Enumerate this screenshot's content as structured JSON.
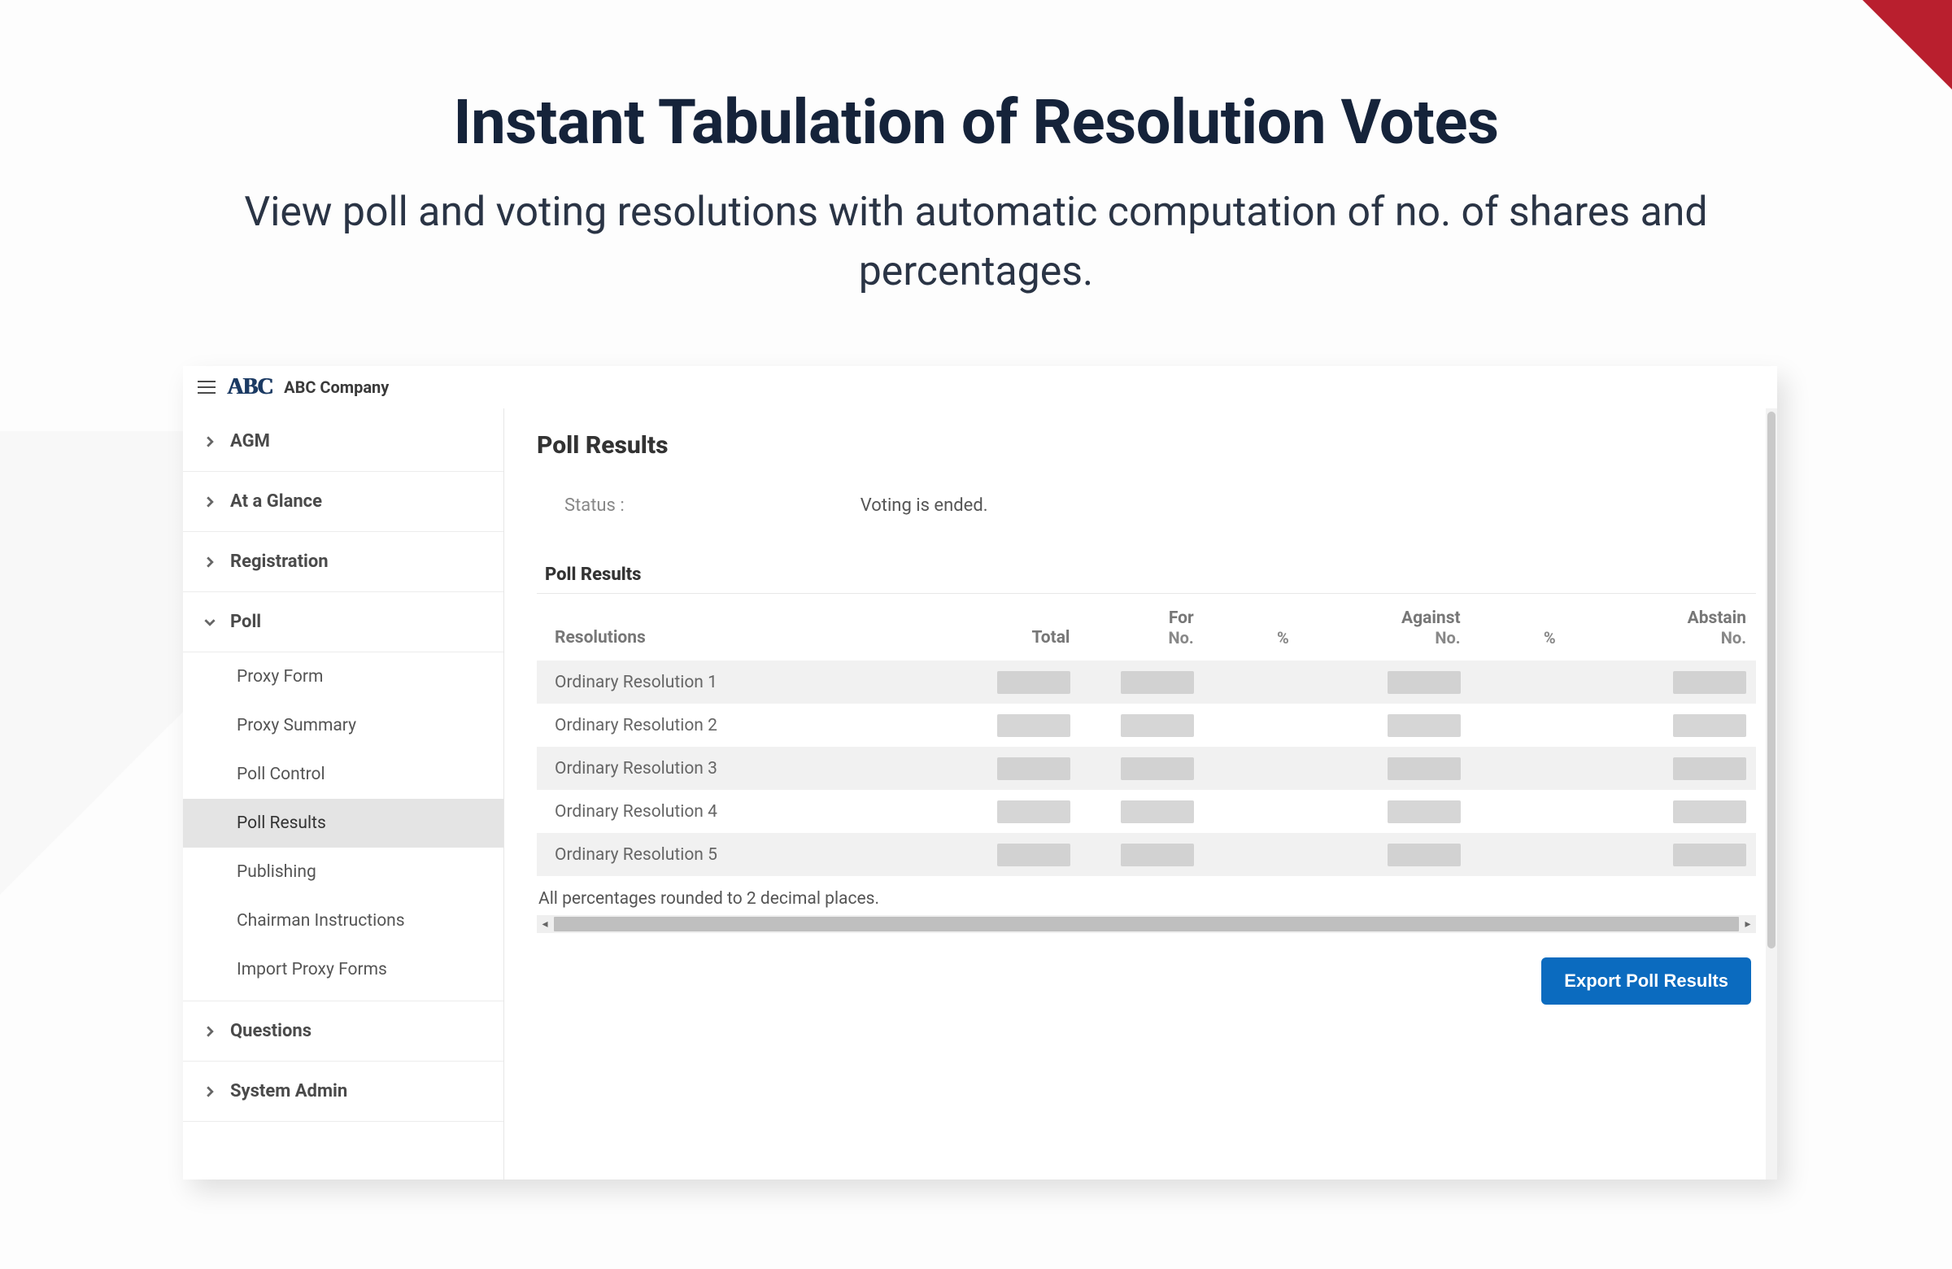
{
  "hero": {
    "title": "Instant Tabulation of Resolution Votes",
    "subtitle": "View poll and voting resolutions with automatic computation of no. of shares and percentages."
  },
  "app": {
    "logo_text": "ABC",
    "company": "ABC Company"
  },
  "sidebar": {
    "items": [
      {
        "label": "AGM",
        "expanded": false
      },
      {
        "label": "At a Glance",
        "expanded": false
      },
      {
        "label": "Registration",
        "expanded": false
      },
      {
        "label": "Poll",
        "expanded": true,
        "children": [
          {
            "label": "Proxy Form",
            "active": false
          },
          {
            "label": "Proxy Summary",
            "active": false
          },
          {
            "label": "Poll Control",
            "active": false
          },
          {
            "label": "Poll Results",
            "active": true
          },
          {
            "label": "Publishing",
            "active": false
          },
          {
            "label": "Chairman Instructions",
            "active": false
          },
          {
            "label": "Import Proxy Forms",
            "active": false
          }
        ]
      },
      {
        "label": "Questions",
        "expanded": false
      },
      {
        "label": "System Admin",
        "expanded": false
      }
    ]
  },
  "main": {
    "page_title": "Poll Results",
    "status_label": "Status :",
    "status_value": "Voting is ended.",
    "section_title": "Poll Results",
    "columns": {
      "resolutions": "Resolutions",
      "total": "Total",
      "for": "For",
      "for_no": "No.",
      "for_pct": "%",
      "against": "Against",
      "against_no": "No.",
      "against_pct": "%",
      "abstain": "Abstain",
      "abstain_no": "No."
    },
    "rows": [
      {
        "name": "Ordinary Resolution 1"
      },
      {
        "name": "Ordinary Resolution 2"
      },
      {
        "name": "Ordinary Resolution 3"
      },
      {
        "name": "Ordinary Resolution 4"
      },
      {
        "name": "Ordinary Resolution 5"
      }
    ],
    "footnote": "All percentages rounded to 2 decimal places.",
    "export_button": "Export Poll Results"
  }
}
